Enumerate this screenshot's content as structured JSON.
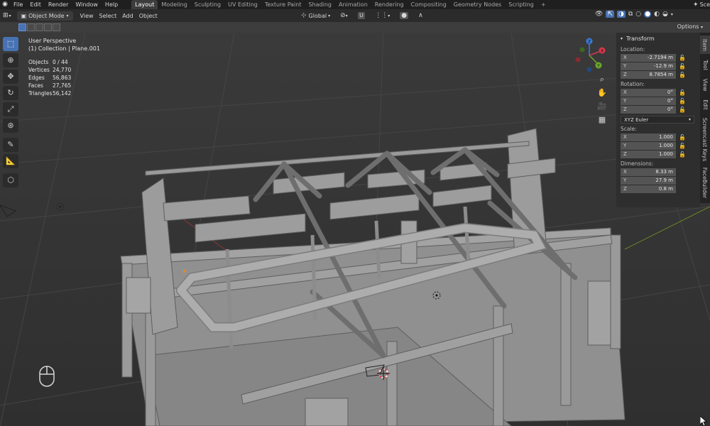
{
  "topbar": {
    "menus": [
      "File",
      "Edit",
      "Render",
      "Window",
      "Help"
    ],
    "workspaces": [
      "Layout",
      "Modeling",
      "Sculpting",
      "UV Editing",
      "Texture Paint",
      "Shading",
      "Animation",
      "Rendering",
      "Compositing",
      "Geometry Nodes",
      "Scripting"
    ],
    "active_workspace": "Layout",
    "add_tab": "+",
    "scene_label": "Sce"
  },
  "header": {
    "mode": "Object Mode",
    "menus": [
      "View",
      "Select",
      "Add",
      "Object"
    ],
    "transform_orientation": "Global",
    "options": "Options"
  },
  "overlay": {
    "perspective": "User Perspective",
    "collection": "(1) Collection | Plane.001",
    "stats": [
      {
        "label": "Objects",
        "value": "0 / 44"
      },
      {
        "label": "Vertices",
        "value": "24,770"
      },
      {
        "label": "Edges",
        "value": "56,863"
      },
      {
        "label": "Faces",
        "value": "27,765"
      },
      {
        "label": "Triangles",
        "value": "56,142"
      }
    ]
  },
  "gizmo": {
    "x": "X",
    "y": "Y",
    "z": "Z"
  },
  "npanel": {
    "title": "Transform",
    "location_label": "Location:",
    "location": [
      {
        "axis": "X",
        "value": "-2.7194 m"
      },
      {
        "axis": "Y",
        "value": "-12.9 m"
      },
      {
        "axis": "Z",
        "value": "8.7854 m"
      }
    ],
    "rotation_label": "Rotation:",
    "rotation": [
      {
        "axis": "X",
        "value": "0°"
      },
      {
        "axis": "Y",
        "value": "0°"
      },
      {
        "axis": "Z",
        "value": "0°"
      }
    ],
    "rotation_mode": "XYZ Euler",
    "scale_label": "Scale:",
    "scale": [
      {
        "axis": "X",
        "value": "1.000"
      },
      {
        "axis": "Y",
        "value": "1.000"
      },
      {
        "axis": "Z",
        "value": "1.000"
      }
    ],
    "dimensions_label": "Dimensions:",
    "dimensions": [
      {
        "axis": "X",
        "value": "8.33 m"
      },
      {
        "axis": "Y",
        "value": "27.9 m"
      },
      {
        "axis": "Z",
        "value": "0.8 m"
      }
    ]
  },
  "side_tabs": [
    "Item",
    "Tool",
    "View",
    "Edit",
    "Screencast Keys",
    "FaceBuilder"
  ],
  "colors": {
    "accent": "#4772b3",
    "axis_x": "#d8384e",
    "axis_y": "#6aa82c",
    "axis_z": "#3a7ad9"
  }
}
